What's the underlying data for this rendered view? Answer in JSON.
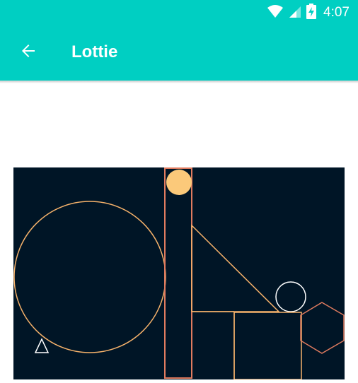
{
  "status_bar": {
    "time": "4:07",
    "icons": [
      "wifi-icon",
      "signal-icon",
      "battery-icon"
    ]
  },
  "app_bar": {
    "title": "Lottie",
    "back_icon": "arrow-back-icon",
    "background_color": "#00CFC2"
  },
  "animation": {
    "background_color": "#001526",
    "stroke_colors": [
      "#F6B26B",
      "#E07B5F",
      "#FFFFFF"
    ],
    "fill_color": "#FBC97A"
  }
}
